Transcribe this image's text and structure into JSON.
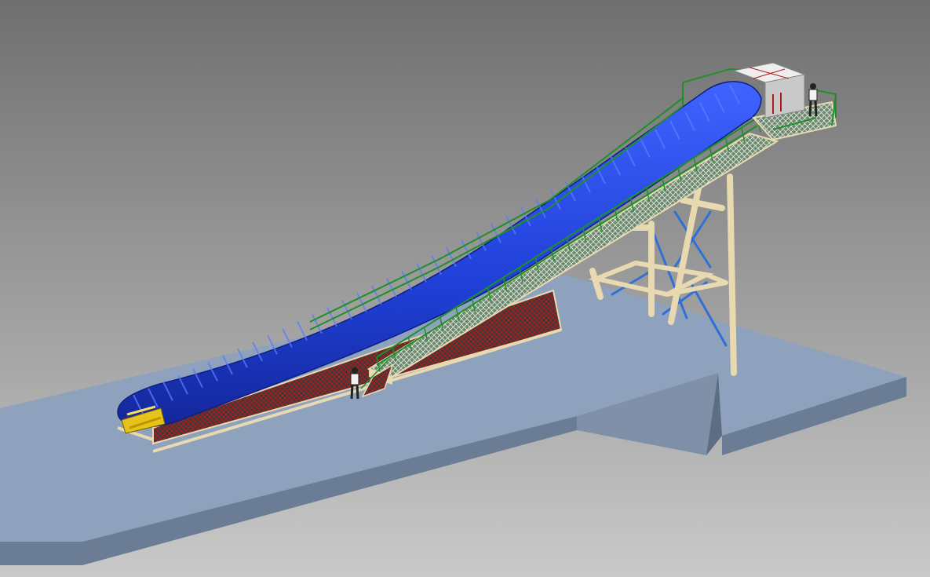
{
  "scene": {
    "description_visible_text": "",
    "colors": {
      "background_top": "#6f6f6f",
      "background_bottom": "#c9c9c9",
      "slab_top": "#8fa2bd",
      "slab_front": "#6b7c95",
      "slab_side": "#7f90a8",
      "belt_cover": "#1f3fd6",
      "belt_cover_highlight": "#3f63ff",
      "handrail": "#1e8f2a",
      "structure": "#e8d9b0",
      "truss_red": "#b11a1a",
      "bracing": "#2f6fd6",
      "roller_yellow": "#e6c21a",
      "headhouse": "#d9d9d9",
      "person": "#222222"
    },
    "objects": [
      "inclined-belt-conveyor",
      "belt-cover",
      "walkway-with-handrails",
      "support-tower",
      "drive-head-house",
      "tail-pulley",
      "access-stair",
      "worker-figure-upper",
      "worker-figure-lower",
      "concrete-slab"
    ]
  }
}
